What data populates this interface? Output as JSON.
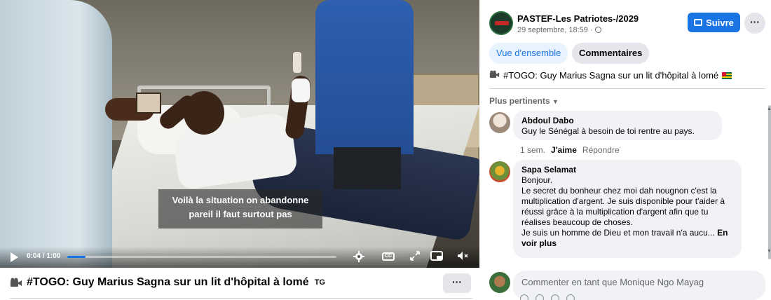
{
  "video": {
    "subtitle_line1": "Voilà la situation on abandonne",
    "subtitle_line2": "pareil il faut surtout pas",
    "time": "0:04 / 1:00",
    "progress_fraction": 0.067,
    "cc_label": "CC"
  },
  "caption": {
    "text": "#TOGO: Guy Marius Sagna sur un lit d'hôpital à lomé",
    "flag_text": "TG",
    "more": "···"
  },
  "post": {
    "page_name": "PASTEF-Les Patriotes-/2029",
    "date": "29 septembre, 18:59 · ",
    "follow_label": "Suivre",
    "more": "···",
    "tab_overview": "Vue d'ensemble",
    "tab_comments": "Commentaires",
    "text": "#TOGO: Guy Marius Sagna sur un lit d'hôpital à lomé"
  },
  "comments": {
    "sort_label": "Plus pertinents",
    "items": [
      {
        "author": "Abdoul Dabo",
        "text": "Guy le Sénégal à besoin de toi rentre au pays.",
        "time": "1 sem.",
        "like": "J'aime",
        "reply": "Répondre"
      },
      {
        "author": "Sapa Selamat",
        "line1": "Bonjour.",
        "line2": "Le secret du bonheur chez moi dah nougnon c'est la",
        "line3": "multiplication d'argent. Je suis disponible pour t'aider à",
        "line4": "réussi grâce à la multiplication d'argent afin que tu",
        "line5": "réalises beaucoup de choses.",
        "line6": "Je suis un homme de Dieu et mon travail n'a aucu...",
        "see_more_1": "En",
        "see_more_2": "voir plus"
      }
    ],
    "input_placeholder": "Commenter en tant que Monique Ngo Mayag"
  }
}
